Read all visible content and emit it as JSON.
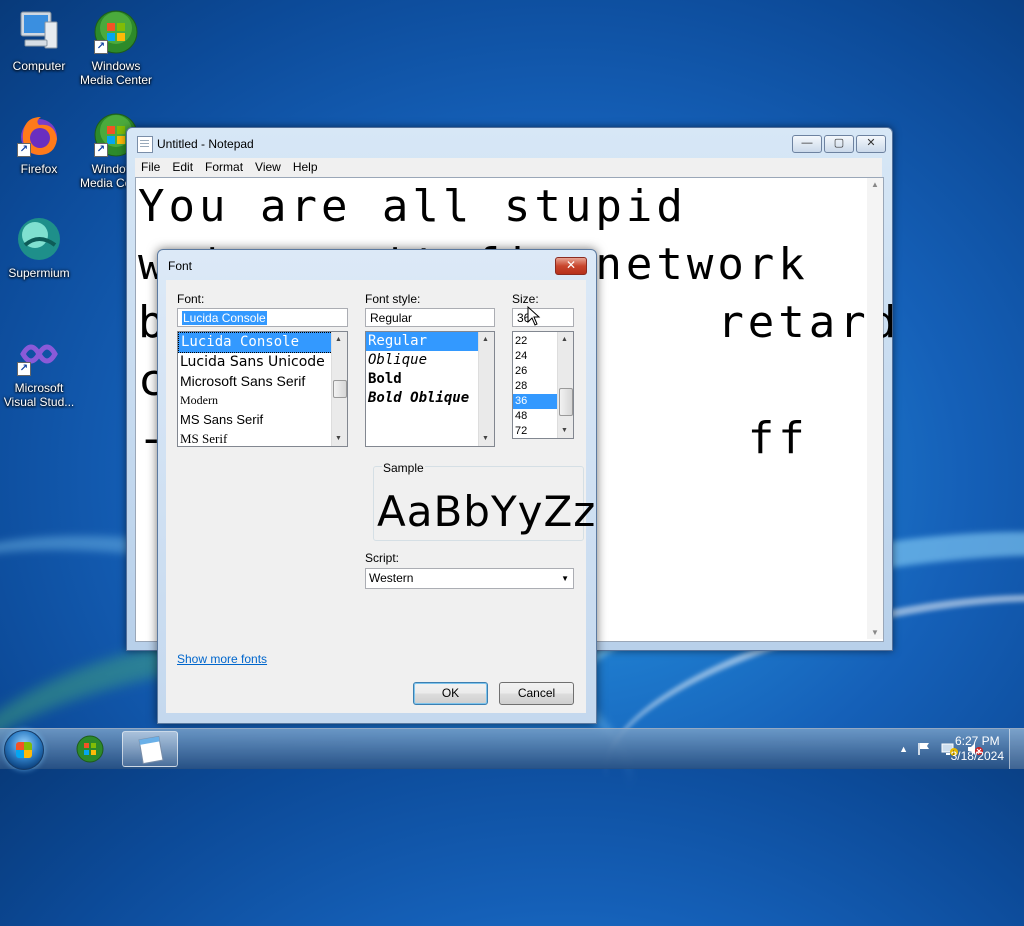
{
  "desktop": {
    "icons": [
      {
        "name": "computer",
        "label": "Computer"
      },
      {
        "name": "windows-media-center",
        "label": "Windows Media Center"
      },
      {
        "name": "firefox",
        "label": "Firefox"
      },
      {
        "name": "windows-media-center-2",
        "label": "Windows Media Center"
      },
      {
        "name": "supermium",
        "label": "Supermium"
      },
      {
        "name": "visual-studio",
        "label": "Microsoft Visual Stud..."
      }
    ]
  },
  "notepad": {
    "title": "Untitled - Notepad",
    "menu": [
      "File",
      "Edit",
      "Format",
      "View",
      "Help"
    ],
    "lines": [
      "You are all stupid",
      "we's won't fix network",
      "b                  retard",
      "c",
      "",
      "-                   ff"
    ],
    "window_buttons": {
      "minimize": "—",
      "maximize": "▢",
      "close": "✕"
    }
  },
  "font_dialog": {
    "title": "Font",
    "close": "✕",
    "font_label": "Font:",
    "font_value": "Lucida Console",
    "font_list": [
      "Lucida Console",
      "Lucida Sans Unicode",
      "Microsoft Sans Serif",
      "Modern",
      "MS Sans Serif",
      "MS Serif"
    ],
    "style_label": "Font style:",
    "style_value": "Regular",
    "style_list": [
      "Regular",
      "Oblique",
      "Bold",
      "Bold Oblique"
    ],
    "size_label": "Size:",
    "size_value": "36",
    "size_list": [
      "22",
      "24",
      "26",
      "28",
      "36",
      "48",
      "72"
    ],
    "sample_label": "Sample",
    "sample_text": "AaBbYyZz",
    "script_label": "Script:",
    "script_value": "Western",
    "show_more": "Show more fonts",
    "ok": "OK",
    "cancel": "Cancel"
  },
  "taskbar": {
    "time": "6:27 PM",
    "date": "3/18/2024",
    "tray_arrow": "▲"
  }
}
